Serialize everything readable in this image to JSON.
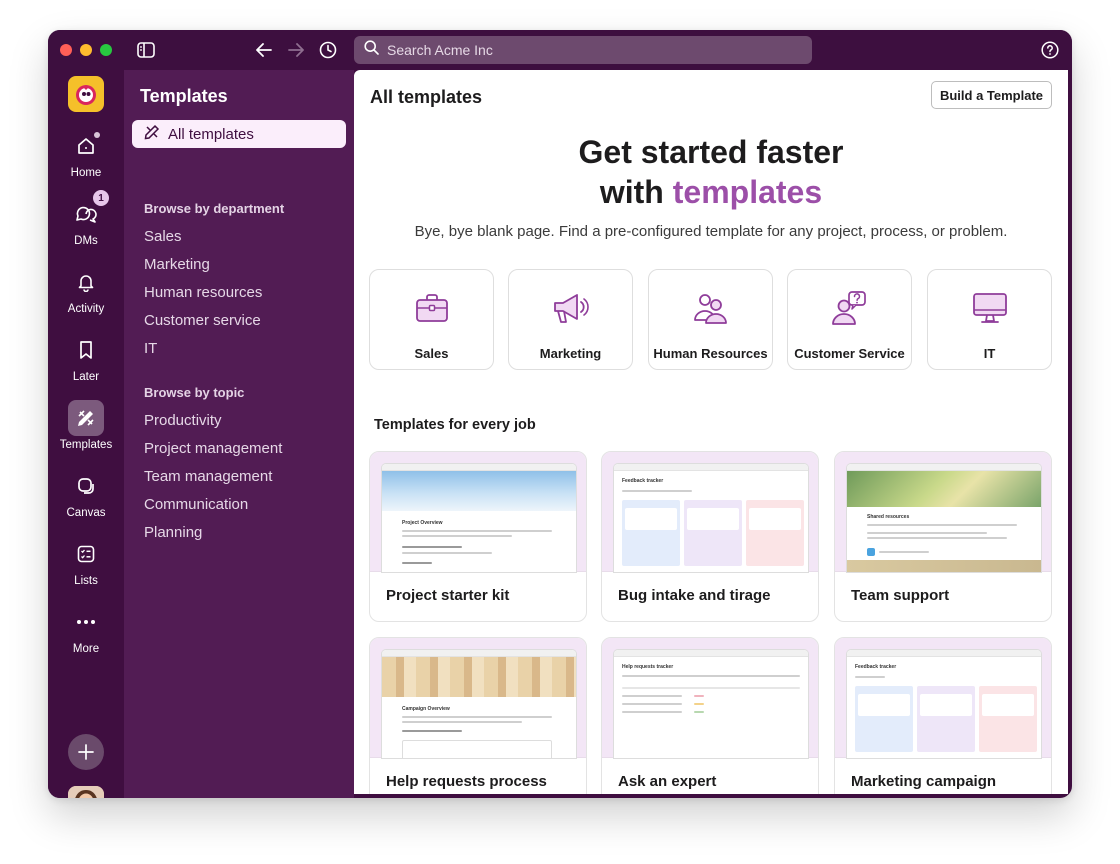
{
  "titlebar": {
    "search_placeholder": "Search Acme Inc"
  },
  "rail": {
    "items": [
      {
        "label": "Home",
        "icon": "home-icon"
      },
      {
        "label": "DMs",
        "icon": "dms-icon",
        "badge": "1"
      },
      {
        "label": "Activity",
        "icon": "bell-icon"
      },
      {
        "label": "Later",
        "icon": "bookmark-icon"
      },
      {
        "label": "Templates",
        "icon": "templates-icon"
      },
      {
        "label": "Canvas",
        "icon": "canvas-icon"
      },
      {
        "label": "Lists",
        "icon": "lists-icon"
      },
      {
        "label": "More",
        "icon": "more-icon"
      }
    ]
  },
  "sidebar": {
    "title": "Templates",
    "active_item": "All templates",
    "department_heading": "Browse by department",
    "departments": [
      "Sales",
      "Marketing",
      "Human resources",
      "Customer service",
      "IT"
    ],
    "topic_heading": "Browse by topic",
    "topics": [
      "Productivity",
      "Project management",
      "Team management",
      "Communication",
      "Planning"
    ]
  },
  "main": {
    "title": "All templates",
    "build_button": "Build a Template",
    "hero_line1": "Get started faster",
    "hero_line2_prefix": "with ",
    "hero_line2_accent": "templates",
    "hero_subtitle": "Bye, bye blank page. Find a pre-configured template for any project, process, or problem.",
    "department_cards": [
      {
        "label": "Sales",
        "icon": "briefcase-icon"
      },
      {
        "label": "Marketing",
        "icon": "megaphone-icon"
      },
      {
        "label": "Human Resources",
        "icon": "people-icon"
      },
      {
        "label": "Customer Service",
        "icon": "question-person-icon"
      },
      {
        "label": "IT",
        "icon": "monitor-icon"
      }
    ],
    "section_title": "Templates for every job",
    "templates": [
      {
        "label": "Project starter kit",
        "preview_heading": "Project Overview"
      },
      {
        "label": "Bug intake and tirage",
        "preview_heading": "Feedback tracker"
      },
      {
        "label": "Team support",
        "preview_heading": "Shared resources"
      },
      {
        "label": "Help requests process",
        "preview_heading": "Campaign Overview"
      },
      {
        "label": "Ask an expert",
        "preview_heading": "Help requests tracker"
      },
      {
        "label": "Marketing campaign",
        "preview_heading": "Feedback tracker"
      }
    ]
  },
  "colors": {
    "aubergine": "#3f0e40",
    "sidebar": "#521c54",
    "accent": "#9c4fa8"
  }
}
